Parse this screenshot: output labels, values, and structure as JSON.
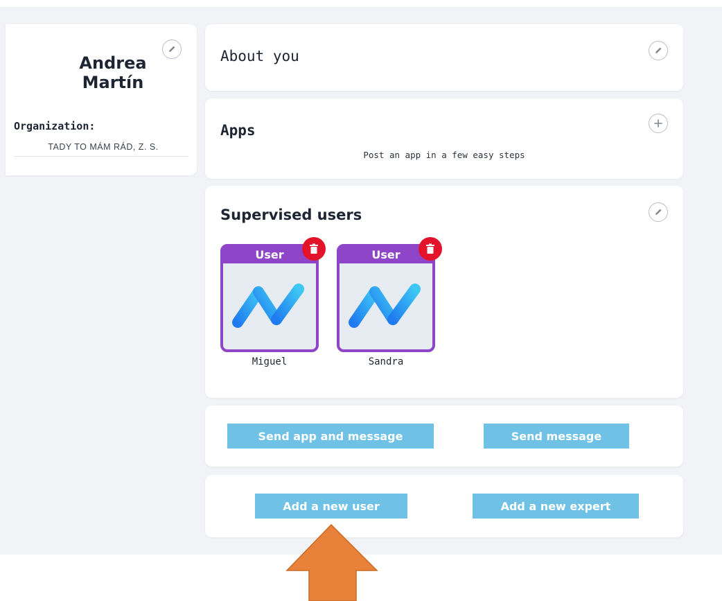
{
  "profile": {
    "name_line1": "Andrea",
    "name_line2": "Martín",
    "org_label": "Organization:",
    "org_value": "TADY TO MÁM RÁD, Z. S."
  },
  "about": {
    "title": "About you"
  },
  "apps": {
    "title": "Apps",
    "subtitle": "Post an app in a few easy steps"
  },
  "supervised": {
    "title": "Supervised users",
    "users": [
      {
        "badge": "User",
        "name": "Miguel"
      },
      {
        "badge": "User",
        "name": "Sandra"
      }
    ]
  },
  "actions": {
    "send_app_message": "Send app and message",
    "send_message": "Send message",
    "add_user": "Add a new user",
    "add_expert": "Add a new expert"
  },
  "colors": {
    "button_blue": "#6fc2e6",
    "tile_purple": "#8f45c7",
    "delete_red": "#e3132b",
    "arrow_orange": "#e8823a"
  },
  "icons": {
    "edit": "pencil-icon",
    "add": "plus-icon",
    "delete": "trash-icon",
    "avatar": "app-logo-icon",
    "pointer": "up-arrow-icon"
  }
}
